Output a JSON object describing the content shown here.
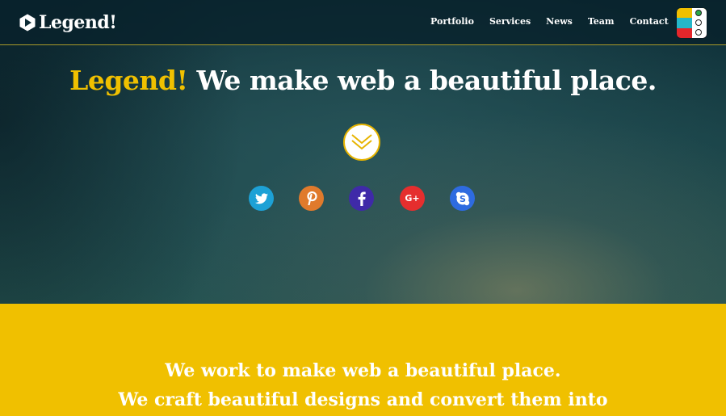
{
  "brand": {
    "name": "Legend!"
  },
  "nav": {
    "items": [
      {
        "label": "Portfolio"
      },
      {
        "label": "Services"
      },
      {
        "label": "News"
      },
      {
        "label": "Team"
      },
      {
        "label": "Contact"
      }
    ]
  },
  "hero": {
    "accent_word": "Legend!",
    "tagline": "We make web a beautiful place."
  },
  "socials": [
    {
      "icon": "twitter-icon",
      "color": "#1da1d6"
    },
    {
      "icon": "pinterest-icon",
      "color": "#e07a2c"
    },
    {
      "icon": "facebook-icon",
      "color": "#3f2aa8"
    },
    {
      "icon": "google-plus-icon",
      "color": "#e52e2e",
      "glyph": "G+"
    },
    {
      "icon": "skype-icon",
      "color": "#2e6be0"
    }
  ],
  "about": {
    "line1": "We work to make web a beautiful place.",
    "line2": "We craft beautiful designs and convert them into"
  },
  "colors": {
    "accent": "#f0c000",
    "hero_dark": "#0c2b35",
    "white": "#ffffff"
  }
}
